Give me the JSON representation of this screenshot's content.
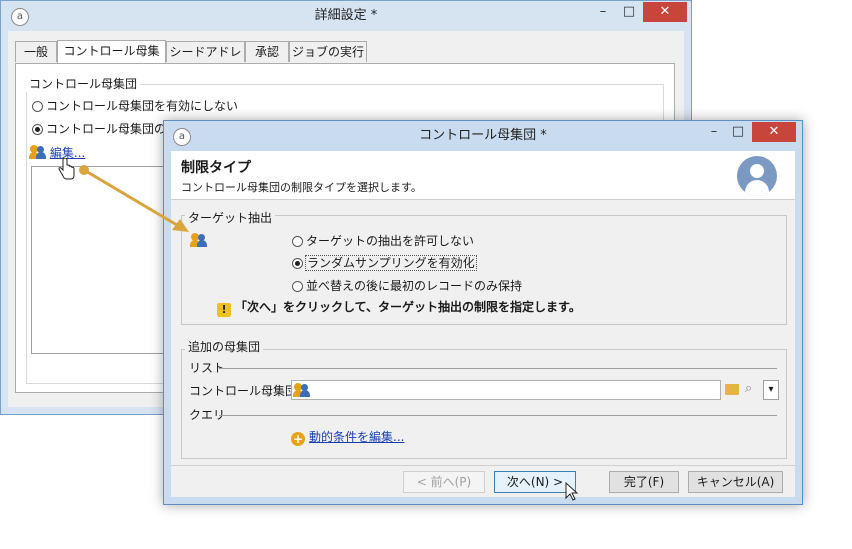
{
  "back_window": {
    "title": "詳細設定 *",
    "tabs": [
      {
        "label": "一般"
      },
      {
        "label": "コントロール母集団"
      },
      {
        "label": "シードアドレス"
      },
      {
        "label": "承認"
      },
      {
        "label": "ジョブの実行"
      }
    ],
    "active_tab": "コントロール母集団",
    "group_label": "コントロール母集団",
    "radio_disable": "コントロール母集団を有効にしない",
    "radio_enable": "コントロール母集団の設",
    "edit_link": "編集..."
  },
  "front_window": {
    "title": "コントロール母集団 *",
    "header_title": "制限タイプ",
    "header_subtitle": "コントロール母集団の制限タイプを選択します。",
    "target_section": {
      "label": "ターゲット抽出",
      "options": [
        {
          "label": "ターゲットの抽出を許可しない",
          "checked": false
        },
        {
          "label": "ランダムサンプリングを有効化",
          "checked": true
        },
        {
          "label": "並べ替えの後に最初のレコードのみ保持",
          "checked": false
        }
      ],
      "warning": "「次へ」をクリックして、ターゲット抽出の制限を指定します。"
    },
    "additional_section": {
      "label": "追加の母集団",
      "list_label": "リスト",
      "field_label": "コントロール母集団:",
      "field_value": "",
      "query_label": "クエリ",
      "add_link": "動的条件を編集..."
    },
    "buttons": {
      "back": "< 前へ(P)",
      "next": "次へ(N) >",
      "finish": "完了(F)",
      "cancel": "キャンセル(A)"
    }
  },
  "colors": {
    "accent_blue": "#3c6fb6",
    "people_orange": "#e3a21a",
    "close_red": "#c7453b",
    "arrow": "#d9a53c"
  }
}
